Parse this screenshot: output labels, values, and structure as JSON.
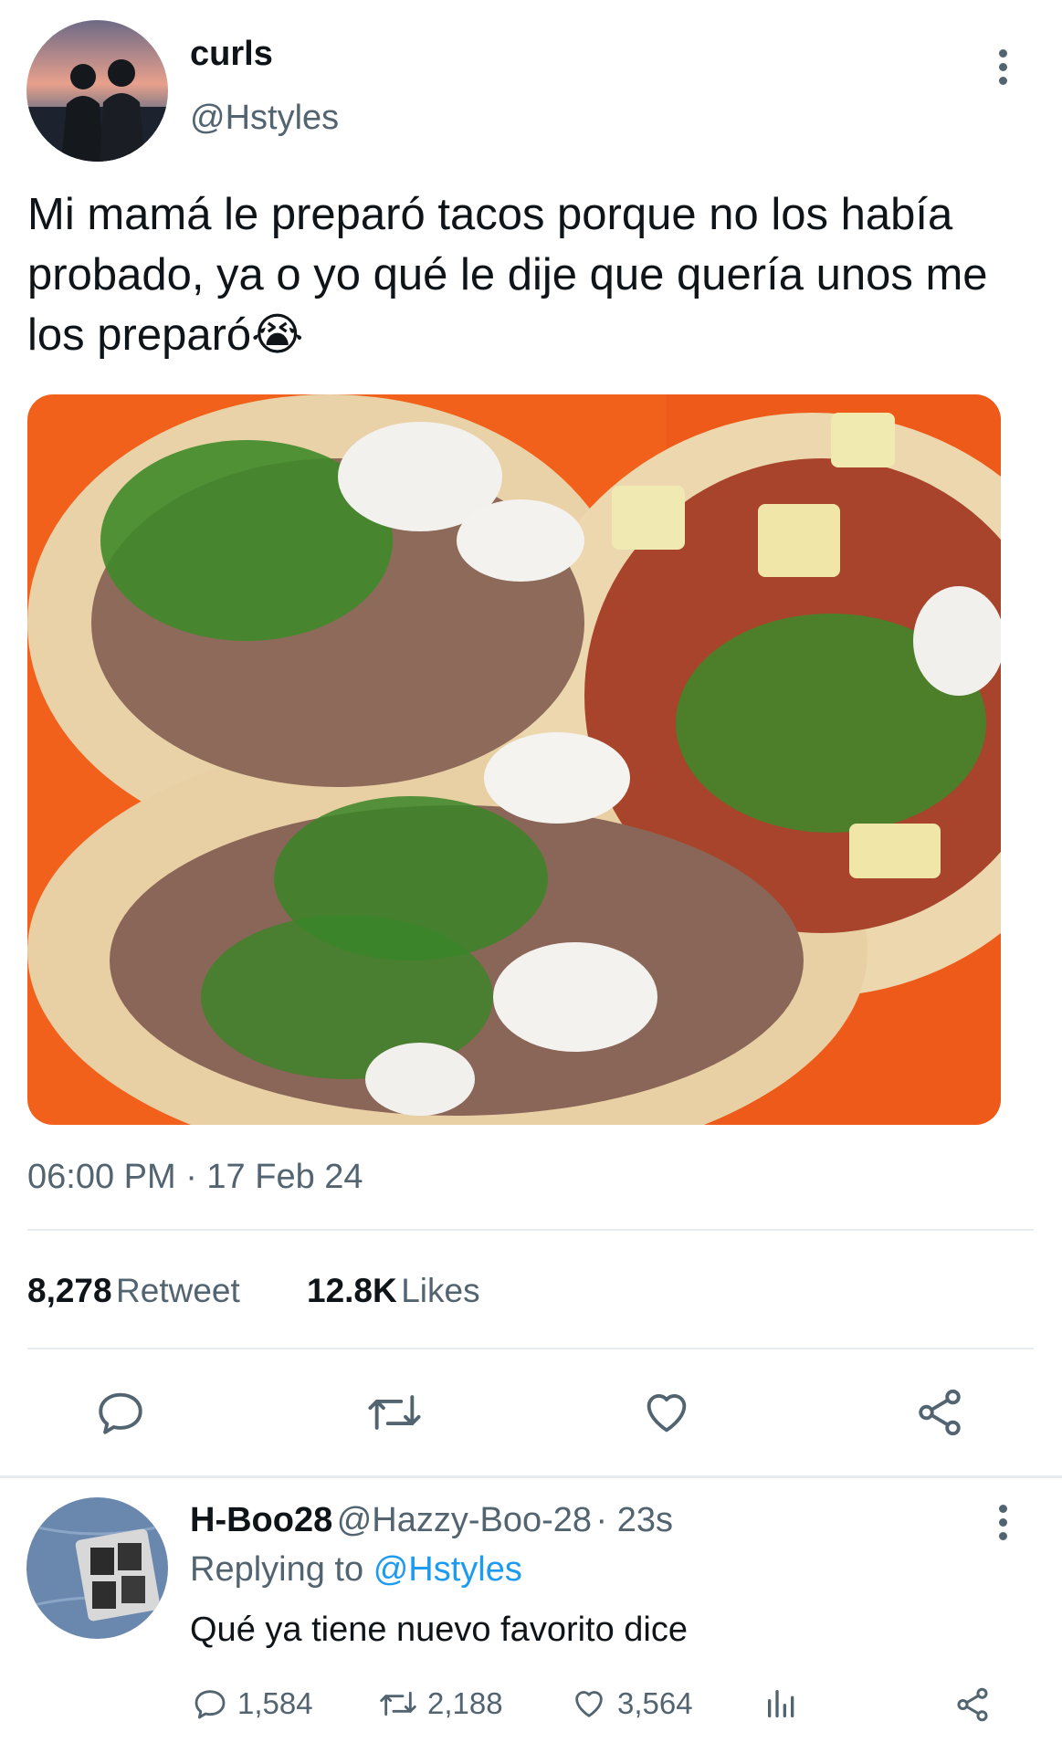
{
  "tweet": {
    "author_name": "curls",
    "author_handle": "@Hstyles",
    "text": "Mi mamá le preparó tacos porque no los había probado, ya o yo qué le dije que quería unos me los preparó",
    "emoji": "😭",
    "timestamp": "06:00 PM · 17 Feb 24",
    "retweets_count": "8,278",
    "retweets_label": "Retweet",
    "likes_count": "12.8K",
    "likes_label": "Likes"
  },
  "actions": {
    "reply_icon": "reply-icon",
    "retweet_icon": "retweet-icon",
    "like_icon": "heart-icon",
    "share_icon": "share-icon"
  },
  "reply": {
    "author_name": "H-Boo28",
    "author_handle": "@Hazzy-Boo-28",
    "time": "· 23s",
    "replying_prefix": "Replying to",
    "replying_to": "@Hstyles",
    "text": "Qué ya tiene nuevo favorito dice",
    "reply_count": "1,584",
    "retweet_count": "2,188",
    "like_count": "3,564"
  },
  "colors": {
    "text": "#0f1419",
    "secondary": "#536471",
    "accent": "#1d9bf0",
    "divider": "#e6ecf0"
  }
}
